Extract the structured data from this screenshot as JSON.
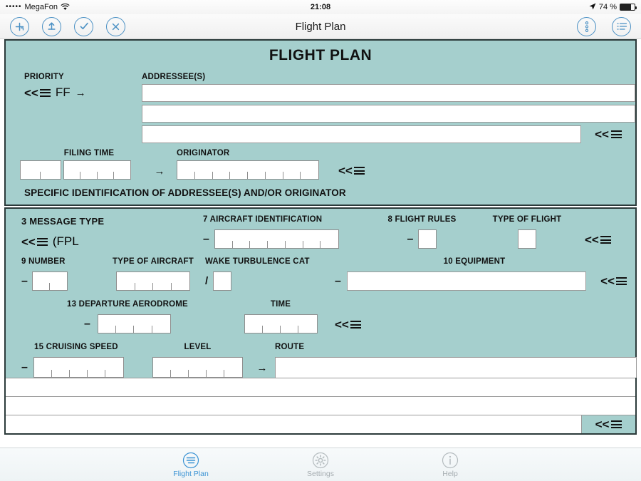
{
  "status_bar": {
    "signal_dots": "•••••",
    "carrier": "MegaFon",
    "wifi_icon": "wifi-icon",
    "time": "21:08",
    "location_icon": "location-arrow-icon",
    "battery_percent": "74 %",
    "battery_level": 74
  },
  "navbar": {
    "title": "Flight Plan",
    "left_buttons": [
      {
        "name": "add-button",
        "icon": "plus-circle-icon"
      },
      {
        "name": "send-button",
        "icon": "upload-circle-icon"
      },
      {
        "name": "validate-button",
        "icon": "check-circle-icon"
      },
      {
        "name": "clear-button",
        "icon": "close-circle-icon"
      }
    ],
    "right_buttons": [
      {
        "name": "more-options-button",
        "icon": "vertical-dots-circle-icon"
      },
      {
        "name": "list-menu-button",
        "icon": "list-circle-icon"
      }
    ]
  },
  "form": {
    "title": "FLIGHT PLAN",
    "priority": {
      "label": "PRIORITY",
      "menu_glyph": "<<",
      "value": "FF",
      "arrow": "→"
    },
    "addressees": {
      "label": "ADDRESSEE(S)",
      "lines": [
        "",
        "",
        ""
      ],
      "menu_glyph": "<<"
    },
    "filing_time": {
      "label": "FILING TIME",
      "group1_cells": 2,
      "group2_cells": 4,
      "value": ""
    },
    "arrow_between": "→",
    "originator": {
      "label": "ORIGINATOR",
      "cells": 8,
      "value": "",
      "menu_glyph": "<<"
    },
    "specific_identification": "SPECIFIC IDENTIFICATION OF ADDRESSEE(S) AND/OR ORIGINATOR",
    "message_type": {
      "label": "3  MESSAGE TYPE",
      "menu_glyph": "<<",
      "value": "(FPL"
    },
    "aircraft_identification": {
      "label": "7  AIRCRAFT IDENTIFICATION",
      "prefix": "–",
      "cells": 7,
      "value": ""
    },
    "flight_rules": {
      "label": "8 FLIGHT RULES",
      "prefix": "–",
      "value": ""
    },
    "type_of_flight": {
      "label": "TYPE OF FLIGHT",
      "value": "",
      "menu_glyph": "<<"
    },
    "number": {
      "label": "9 NUMBER",
      "prefix": "–",
      "cells": 2,
      "value": ""
    },
    "type_of_aircraft": {
      "label": "TYPE OF AIRCRAFT",
      "cells": 4,
      "value": ""
    },
    "wake_turbulence": {
      "label": "WAKE TURBULENCE CAT",
      "separator": "/",
      "value": ""
    },
    "equipment": {
      "label": "10 EQUIPMENT",
      "prefix": "–",
      "value": "",
      "menu_glyph": "<<"
    },
    "departure_aerodrome": {
      "label": "13 DEPARTURE AERODROME",
      "prefix": "–",
      "cells": 4,
      "value": ""
    },
    "departure_time": {
      "label": "TIME",
      "cells": 4,
      "value": "",
      "menu_glyph": "<<"
    },
    "cruising_speed": {
      "label": "15 CRUISING SPEED",
      "prefix": "–",
      "cells": 5,
      "value": ""
    },
    "level": {
      "label": "LEVEL",
      "cells": 5,
      "value": ""
    },
    "route": {
      "label": "ROUTE",
      "arrow": "→",
      "lines": [
        "",
        "",
        "",
        ""
      ],
      "menu_glyph": "<<"
    }
  },
  "tabbar": {
    "tabs": [
      {
        "label": "Flight Plan",
        "icon": "flight-plan-icon",
        "active": true
      },
      {
        "label": "Settings",
        "icon": "gear-icon",
        "active": false
      },
      {
        "label": "Help",
        "icon": "info-icon",
        "active": false
      }
    ]
  },
  "colors": {
    "form_background": "#a5cfcd",
    "form_border": "#2b3a3a",
    "accent_blue": "#4a90c4",
    "tab_active": "#3b93d4",
    "tab_inactive": "#a6adb1"
  }
}
